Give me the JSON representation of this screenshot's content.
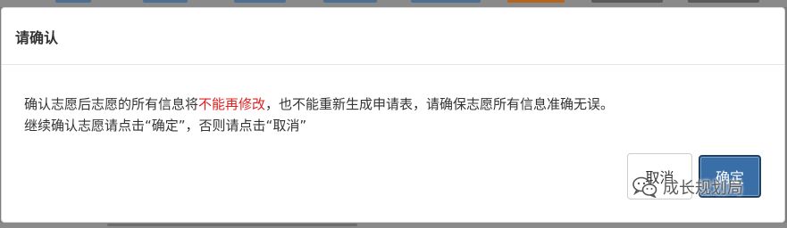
{
  "dialog": {
    "title": "请确认",
    "message": {
      "line1_pre": "确认志愿后志愿的所有信息将",
      "line1_warn": "不能再修改",
      "line1_post": "，也不能重新生成申请表，请确保志愿所有信息准确无误。",
      "line2": "继续确认志愿请点击“确定”，否则请点击“取消”"
    },
    "cancel_label": "取消",
    "ok_label": "确定"
  },
  "watermark": {
    "text": "成长规划局",
    "icon": "wechat-icon"
  },
  "colors": {
    "warning": "#e02020",
    "primary_button": "#3a6ea7",
    "overlay": "#7d7d7d"
  }
}
